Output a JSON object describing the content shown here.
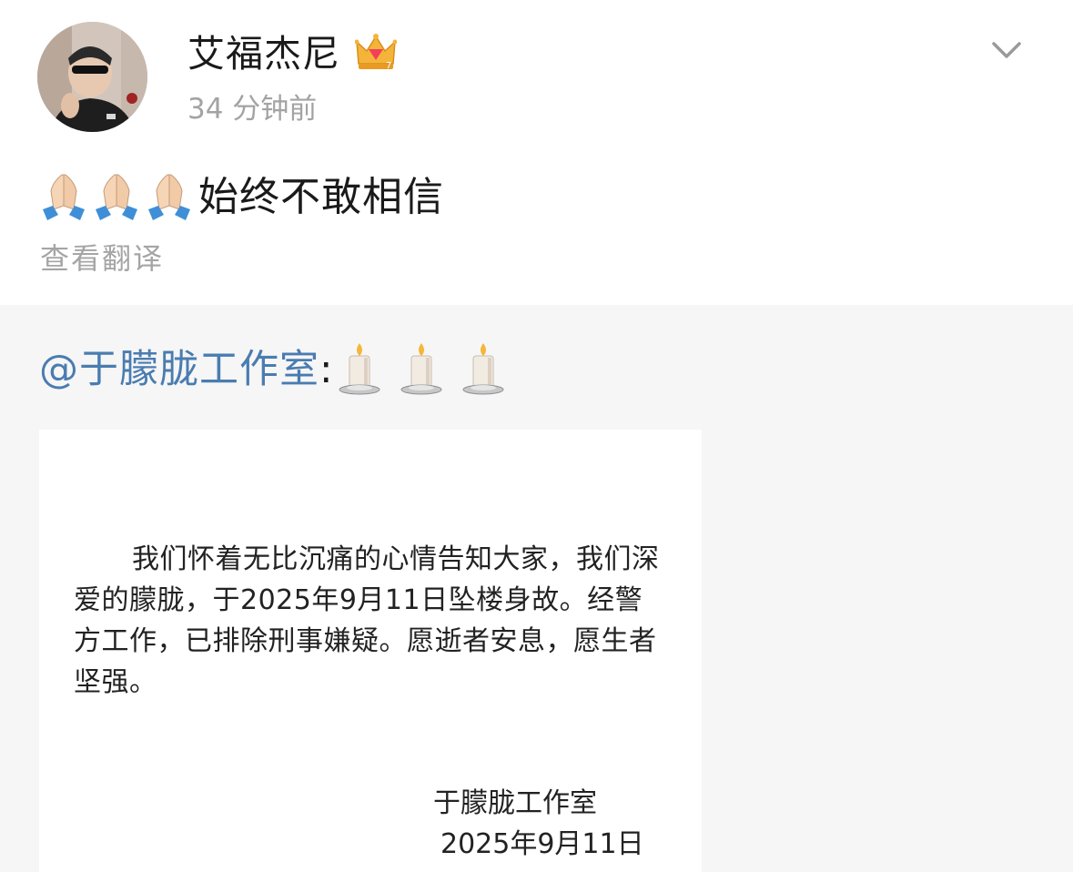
{
  "post": {
    "author_name": "艾福杰尼",
    "timestamp": "34 分钟前",
    "text": "始终不敢相信",
    "translate_label": "查看翻译",
    "emoji_count": 3
  },
  "repost": {
    "mention": "@于朦胧工作室",
    "colon": ":",
    "statement": {
      "body": "我们怀着无比沉痛的心情告知大家，我们深爱的朦胧，于2025年9月11日坠楼身故。经警方工作，已排除刑事嫌疑。愿逝者安息，愿生者坚强。",
      "signature": "于朦胧工作室",
      "date": "2025年9月11日"
    }
  },
  "colors": {
    "mention_link": "#4a7cb0",
    "muted_text": "#a3a3a3",
    "repost_bg": "#f6f6f6"
  },
  "icons": {
    "crown": "crown-icon",
    "chevron": "chevron-down-icon",
    "pray": "folded-hands-emoji",
    "candle": "candle-emoji"
  }
}
